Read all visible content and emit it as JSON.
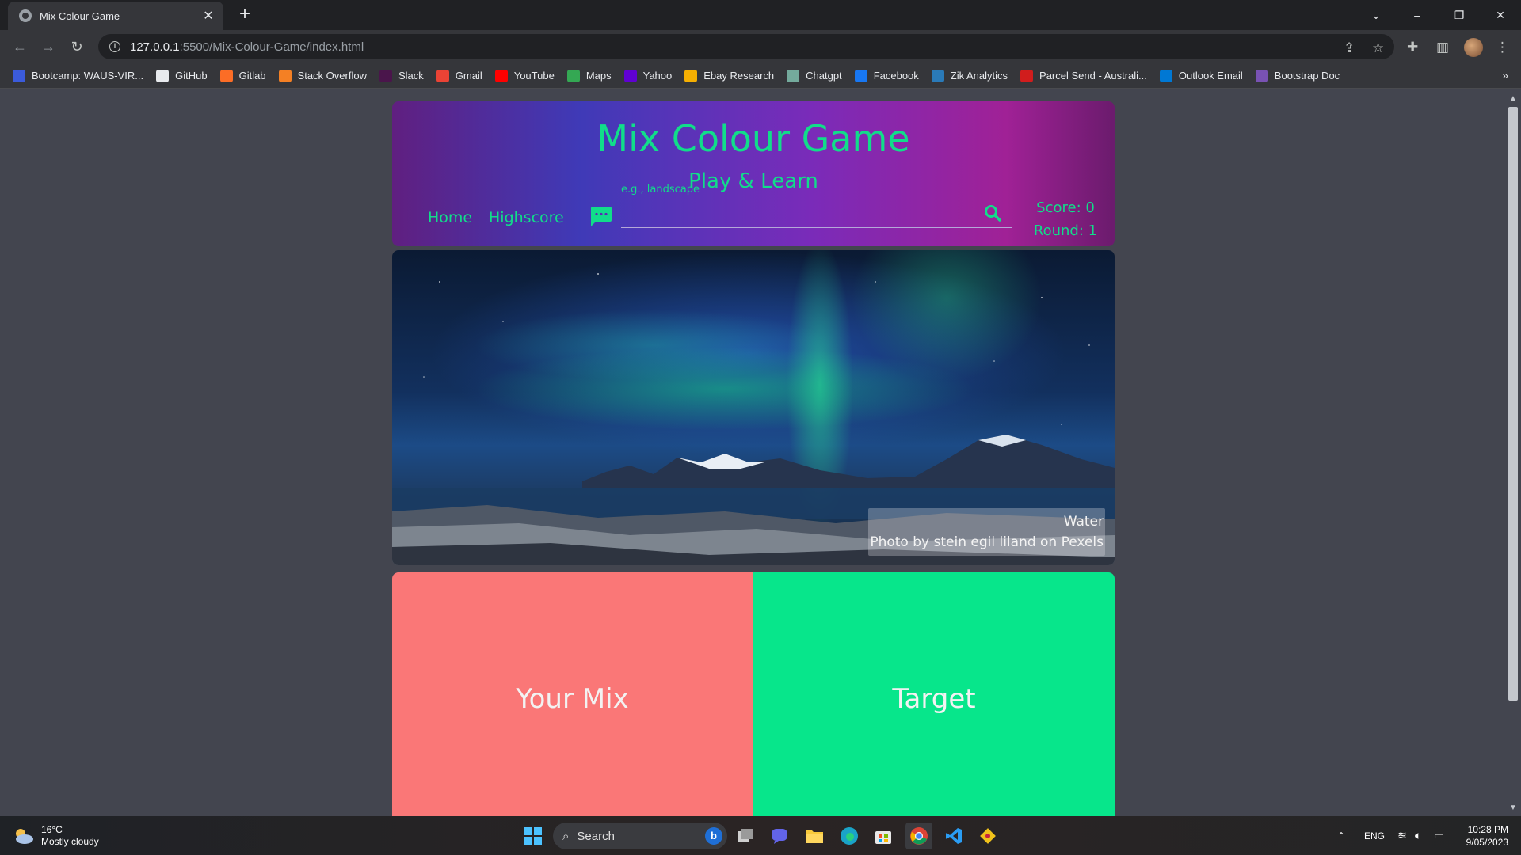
{
  "browser": {
    "tab_title": "Mix Colour Game",
    "url_host": "127.0.0.1",
    "url_rest": ":5500/Mix-Colour-Game/index.html",
    "bookmarks": [
      {
        "label": "Bootcamp: WAUS-VIR...",
        "icon": "bootcamp-icon",
        "color": "#3b5bdb"
      },
      {
        "label": "GitHub",
        "icon": "github-icon",
        "color": "#e8eaed"
      },
      {
        "label": "Gitlab",
        "icon": "gitlab-icon",
        "color": "#fc6d26"
      },
      {
        "label": "Stack Overflow",
        "icon": "stackoverflow-icon",
        "color": "#f48024"
      },
      {
        "label": "Slack",
        "icon": "slack-icon",
        "color": "#4a154b"
      },
      {
        "label": "Gmail",
        "icon": "gmail-icon",
        "color": "#ea4335"
      },
      {
        "label": "YouTube",
        "icon": "youtube-icon",
        "color": "#ff0000"
      },
      {
        "label": "Maps",
        "icon": "maps-icon",
        "color": "#34a853"
      },
      {
        "label": "Yahoo",
        "icon": "yahoo-icon",
        "color": "#6001d2"
      },
      {
        "label": "Ebay Research",
        "icon": "ebay-icon",
        "color": "#f5af02"
      },
      {
        "label": "Chatgpt",
        "icon": "chatgpt-icon",
        "color": "#74aa9c"
      },
      {
        "label": "Facebook",
        "icon": "facebook-icon",
        "color": "#1877f2"
      },
      {
        "label": "Zik Analytics",
        "icon": "zik-icon",
        "color": "#2a7ab8"
      },
      {
        "label": "Parcel Send - Australi...",
        "icon": "parcel-icon",
        "color": "#d11d1d"
      },
      {
        "label": "Outlook Email",
        "icon": "outlook-icon",
        "color": "#0078d4"
      },
      {
        "label": "Bootstrap Doc",
        "icon": "bootstrap-icon",
        "color": "#7952b3"
      }
    ]
  },
  "game": {
    "title": "Mix Colour Game",
    "subtitle": "Play & Learn",
    "nav": {
      "home": "Home",
      "highscore": "Highscore"
    },
    "search_placeholder": "e.g., landscape",
    "score": "Score: 0",
    "round": "Round: 1",
    "photo_caption_line1": "Water",
    "photo_caption_line2": "Photo by stein egil liland on Pexels",
    "your_mix_label": "Your Mix",
    "target_label": "Target",
    "colors": {
      "accent": "#11dd8a",
      "your_mix": "#fa7777",
      "target": "#07e68b"
    }
  },
  "taskbar": {
    "weather_temp": "16°C",
    "weather_desc": "Mostly cloudy",
    "search_label": "Search",
    "lang": "ENG",
    "time": "10:28 PM",
    "date": "9/05/2023"
  }
}
